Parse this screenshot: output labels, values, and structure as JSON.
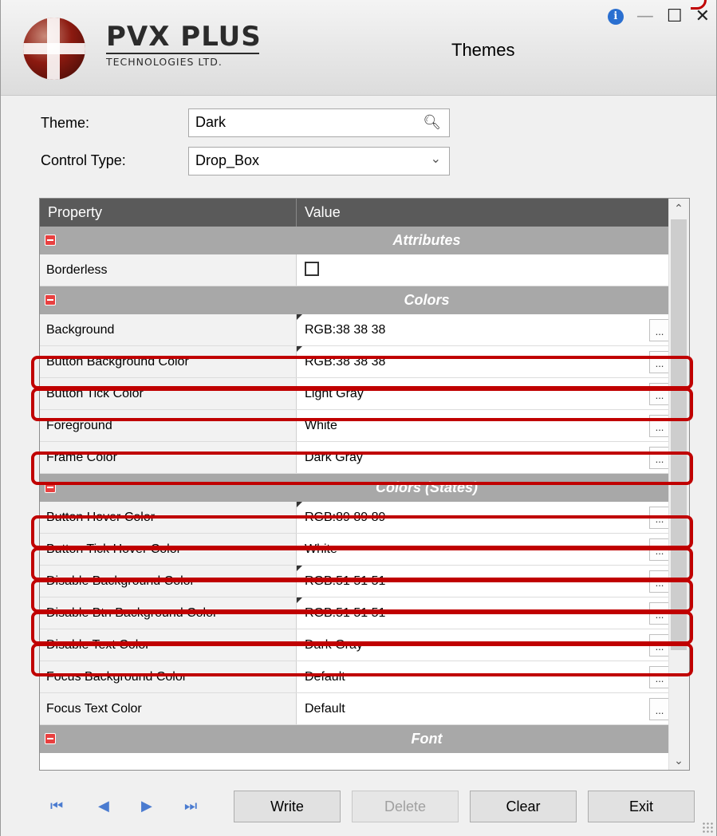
{
  "window": {
    "title": "Themes",
    "logo_main": "PVX PLUS",
    "logo_sub": "TECHNOLOGIES LTD.",
    "controls": {
      "info": "i",
      "minimize": "—",
      "maximize": "☐",
      "close": "✕"
    }
  },
  "form": {
    "theme_label": "Theme:",
    "theme_value": "Dark",
    "control_type_label": "Control Type:",
    "control_type_value": "Drop_Box"
  },
  "grid": {
    "col_property": "Property",
    "col_value": "Value",
    "sections": [
      {
        "title": "Attributes"
      },
      {
        "title": "Colors"
      },
      {
        "title": "Colors (States)"
      },
      {
        "title": "Font"
      }
    ],
    "rows": [
      {
        "property": "Borderless",
        "value": ""
      },
      {
        "property": "Background",
        "value": "RGB:38 38 38"
      },
      {
        "property": "Button Background Color",
        "value": "RGB:38 38 38"
      },
      {
        "property": "Button Tick Color",
        "value": "Light Gray"
      },
      {
        "property": "Foreground",
        "value": "White"
      },
      {
        "property": "Frame Color",
        "value": "Dark Gray"
      },
      {
        "property": "Button Hover Color",
        "value": "RGB:89 89 89"
      },
      {
        "property": "Button Tick Hover Color",
        "value": "White"
      },
      {
        "property": "Disable Background Color",
        "value": "RGB:51 51 51"
      },
      {
        "property": "Disable Btn Background Color",
        "value": "RGB:51 51 51"
      },
      {
        "property": "Disable Text Color",
        "value": "Dark Gray"
      },
      {
        "property": "Focus Background Color",
        "value": "Default"
      },
      {
        "property": "Focus Text Color",
        "value": "Default"
      }
    ],
    "ellipsis": "..."
  },
  "buttons": {
    "write": "Write",
    "delete": "Delete",
    "clear": "Clear",
    "exit": "Exit"
  },
  "nav": {
    "first": "⏮",
    "prev": "◀",
    "next": "▶",
    "last": "⏭"
  },
  "colors": {
    "highlight": "#c00000",
    "header": "#5a5a5a",
    "section": "#a8a8a8"
  }
}
